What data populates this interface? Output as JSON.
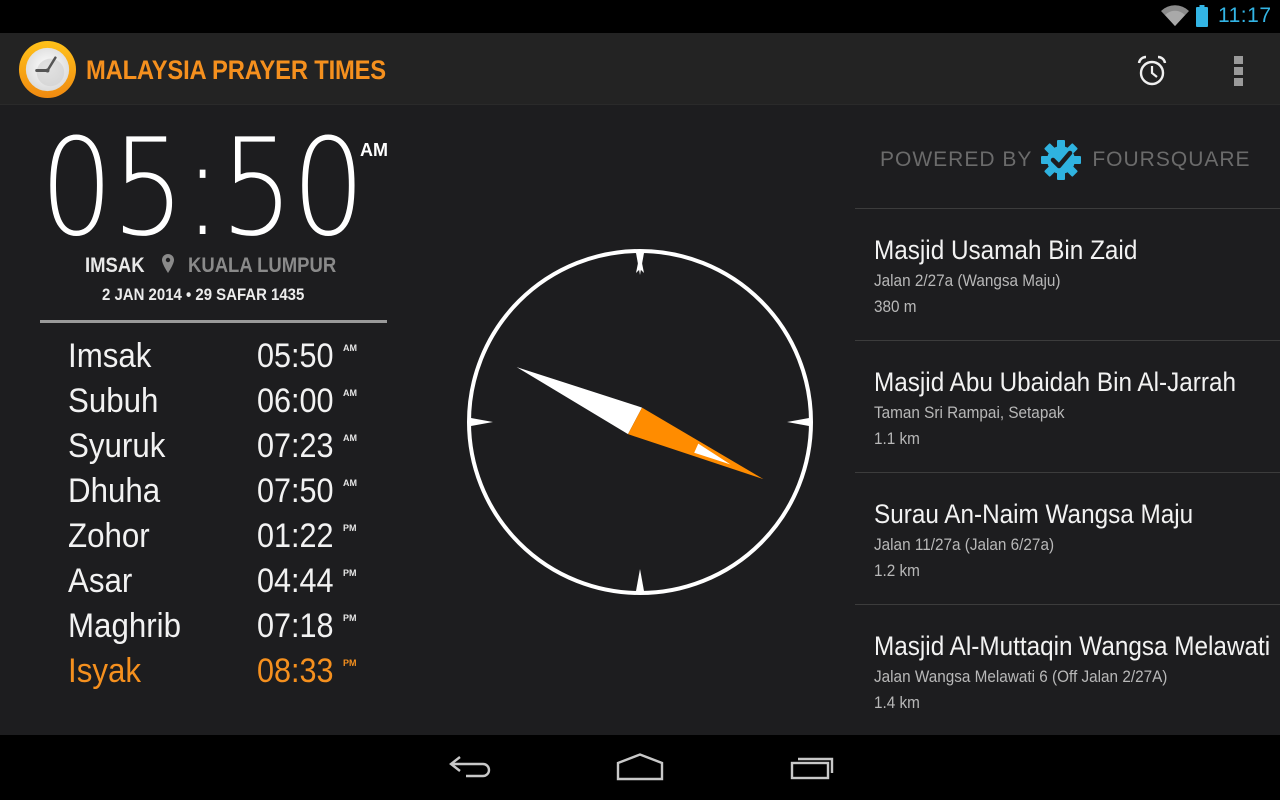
{
  "status_bar": {
    "time": "11:17",
    "icons": [
      "wifi-icon",
      "battery-icon"
    ],
    "accent": "#33b5e5"
  },
  "action_bar": {
    "title": "MALAYSIA PRAYER TIMES",
    "title_color": "#f5901e",
    "actions": [
      {
        "name": "alarm",
        "icon": "alarm-clock-icon"
      },
      {
        "name": "overflow-menu",
        "icon": "more-vert-icon"
      }
    ]
  },
  "current": {
    "time": "05:50",
    "ampm": "AM",
    "prayer": "IMSAK",
    "location": "KUALA LUMPUR",
    "date": "2 JAN 2014 • 29 SAFAR 1435"
  },
  "prayers": [
    {
      "name": "Imsak",
      "time": "05:50",
      "ampm": "AM",
      "active": false
    },
    {
      "name": "Subuh",
      "time": "06:00",
      "ampm": "AM",
      "active": false
    },
    {
      "name": "Syuruk",
      "time": "07:23",
      "ampm": "AM",
      "active": false
    },
    {
      "name": "Dhuha",
      "time": "07:50",
      "ampm": "AM",
      "active": false
    },
    {
      "name": "Zohor",
      "time": "01:22",
      "ampm": "PM",
      "active": false
    },
    {
      "name": "Asar",
      "time": "04:44",
      "ampm": "PM",
      "active": false
    },
    {
      "name": "Maghrib",
      "time": "07:18",
      "ampm": "PM",
      "active": false
    },
    {
      "name": "Isyak",
      "time": "08:33",
      "ampm": "PM",
      "active": true
    }
  ],
  "compass": {
    "qibla_bearing_deg": 114,
    "needle_colors": {
      "tail": "#ffffff",
      "head": "#ff8c00"
    }
  },
  "powered_by": {
    "prefix": "POWERED BY",
    "brand": "FOURSQUARE",
    "logo_color": "#2fb3e0"
  },
  "mosques": [
    {
      "name": "Masjid Usamah Bin Zaid",
      "address": "Jalan 2/27a (Wangsa Maju)",
      "distance": "380 m"
    },
    {
      "name": "Masjid Abu Ubaidah Bin Al-Jarrah",
      "address": "Taman Sri Rampai, Setapak",
      "distance": "1.1 km"
    },
    {
      "name": "Surau An-Naim Wangsa Maju",
      "address": "Jalan 11/27a (Jalan 6/27a)",
      "distance": "1.2 km"
    },
    {
      "name": "Masjid Al-Muttaqin Wangsa Melawati",
      "address": "Jalan Wangsa Melawati 6 (Off Jalan 2/27A)",
      "distance": "1.4 km"
    }
  ],
  "nav_bar": {
    "buttons": [
      "back",
      "home",
      "recent-apps"
    ]
  }
}
